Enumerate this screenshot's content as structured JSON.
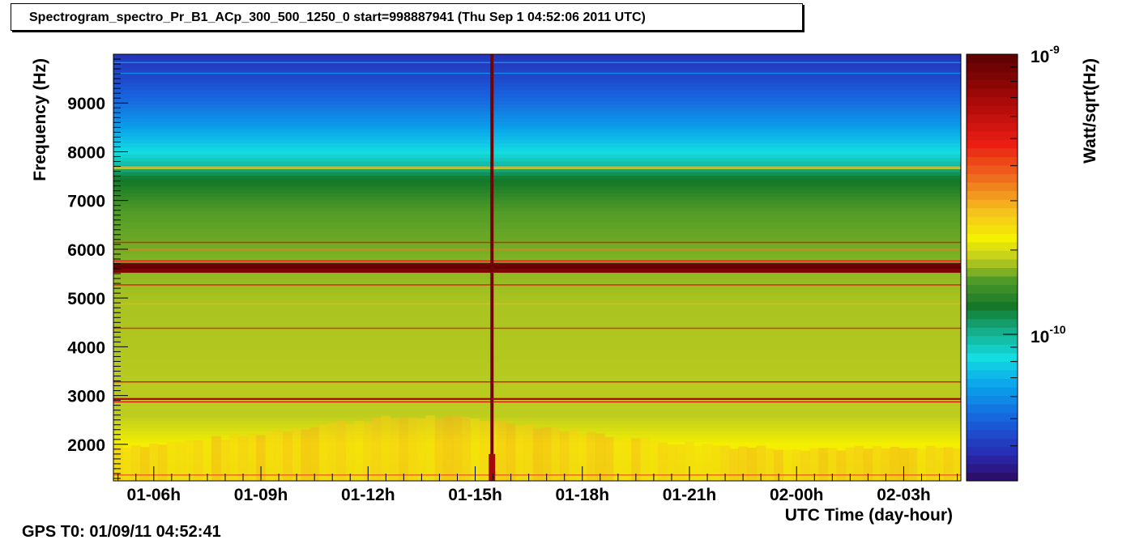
{
  "title": "Spectrogram_spectro_Pr_B1_ACp_300_500_1250_0 start=998887941 (Thu Sep  1 04:52:06 2011 UTC)",
  "footer": "GPS T0: 01/09/11 04:52:41",
  "chart_data": {
    "type": "heatmap",
    "xlabel": "UTC Time (day-hour)",
    "ylabel": "Frequency (Hz)",
    "zlabel": "Watt/sqrt(Hz)",
    "x_tick_labels": [
      "01-06h",
      "01-09h",
      "01-12h",
      "01-15h",
      "01-18h",
      "01-21h",
      "02-00h",
      "02-03h"
    ],
    "x_tick_hours": [
      6,
      9,
      12,
      15,
      18,
      21,
      24,
      27
    ],
    "xlim_hours": [
      4.87,
      28.6
    ],
    "ylim": [
      1250,
      10000
    ],
    "y_ticks": [
      2000,
      3000,
      4000,
      5000,
      6000,
      7000,
      8000,
      9000
    ],
    "y_tick_labels": [
      "2000",
      "3000",
      "4000",
      "5000",
      "6000",
      "7000",
      "8000",
      "9000"
    ],
    "z_scale": "log",
    "zlim": [
      3e-11,
      1e-09
    ],
    "z_tick_labels": [
      {
        "base": "10",
        "exp": "-9",
        "value": 1e-09
      },
      {
        "base": "10",
        "exp": "-10",
        "value": 1e-10
      }
    ],
    "profile_vs_frequency": [
      {
        "f": 1250,
        "level": 0.56
      },
      {
        "f": 2000,
        "level": 0.57
      },
      {
        "f": 2600,
        "level": 0.52
      },
      {
        "f": 5000,
        "level": 0.51
      },
      {
        "f": 6800,
        "level": 0.47
      },
      {
        "f": 7500,
        "level": 0.4
      },
      {
        "f": 7700,
        "level": 0.34
      },
      {
        "f": 8000,
        "level": 0.29
      },
      {
        "f": 8500,
        "level": 0.22
      },
      {
        "f": 9000,
        "level": 0.16
      },
      {
        "f": 9500,
        "level": 0.11
      },
      {
        "f": 10000,
        "level": 0.08
      }
    ],
    "lines_frequency": [
      {
        "f": 9830,
        "level": 0.2
      },
      {
        "f": 9610,
        "level": 0.19
      },
      {
        "f": 7690,
        "level": 0.66
      },
      {
        "f": 7660,
        "level": 0.55
      },
      {
        "f": 6140,
        "level": 0.8
      },
      {
        "f": 6000,
        "level": 0.7
      },
      {
        "f": 5760,
        "level": 0.8
      },
      {
        "f": 5680,
        "level": 0.97
      },
      {
        "f": 5620,
        "level": 0.99
      },
      {
        "f": 5560,
        "level": 0.95
      },
      {
        "f": 5270,
        "level": 0.8
      },
      {
        "f": 4880,
        "level": 0.65
      },
      {
        "f": 4380,
        "level": 0.78
      },
      {
        "f": 3280,
        "level": 0.82
      },
      {
        "f": 2930,
        "level": 0.9
      },
      {
        "f": 2870,
        "level": 0.82
      },
      {
        "f": 1370,
        "level": 0.72
      }
    ],
    "glitches_time": [
      {
        "hour": 15.47,
        "level": 0.97
      }
    ],
    "broadband_bump": {
      "f_range": [
        1500,
        2500
      ],
      "peak_hour": 13.5,
      "level_boost": 0.08
    }
  }
}
